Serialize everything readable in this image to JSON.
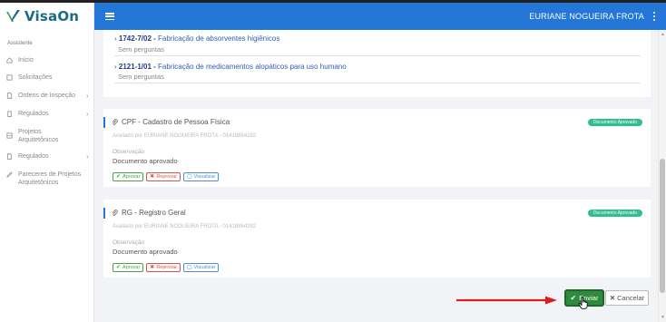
{
  "app": {
    "name": "VisaOn",
    "colors": {
      "header": "#2477d7",
      "logo_text": "#1c6b86",
      "success": "#2fbe8d",
      "send": "#2e8b3e"
    }
  },
  "header": {
    "menu_icon": "hamburger-icon",
    "user_name": "EURIANE NOGUEIRA FROTA",
    "options_icon": "kebab-icon"
  },
  "sidebar": {
    "section": "Assistente",
    "items": [
      {
        "label": "Início",
        "icon": "home-icon",
        "chevron": false
      },
      {
        "label": "Solicitações",
        "icon": "document-icon",
        "chevron": false
      },
      {
        "label": "Ordens de Inspeção",
        "icon": "file-icon",
        "chevron": true
      },
      {
        "label": "Regulados",
        "icon": "building-icon",
        "chevron": true
      },
      {
        "label": "Projetos Arquitetônicos",
        "icon": "blueprint-icon",
        "chevron": false
      },
      {
        "label": "Regulados",
        "icon": "file-icon",
        "chevron": true
      },
      {
        "label": "Pareceres de Projetos Arquitetônicos",
        "icon": "pen-icon",
        "chevron": false
      }
    ]
  },
  "activities": [
    {
      "code": "1742-7/02",
      "separator": " - ",
      "description": "Fabricação de absorventes higiênicos",
      "note": "Sem perguntas"
    },
    {
      "code": "2121-1/01",
      "separator": " - ",
      "description": "Fabricação de medicamentos alopáticos para uso humano",
      "note": "Sem perguntas"
    }
  ],
  "documents": [
    {
      "title": "CPF - Cadastro de Pessoa Física",
      "status": "Documento Aprovado",
      "evaluated_by": "Avaliado por EURIANE NOGUEIRA FROTA - 01418864282",
      "observation_label": "Observação",
      "observation": "Documento aprovado",
      "actions": {
        "approve": "Aprovar",
        "reject": "Reprovar",
        "view": "Visualizar"
      }
    },
    {
      "title": "RG - Registro Geral",
      "status": "Documento Aprovado",
      "evaluated_by": "Avaliado por EURIANE NOGUEIRA FROTA - 01418864282",
      "observation_label": "Observação",
      "observation": "Documento aprovado",
      "actions": {
        "approve": "Aprovar",
        "reject": "Reprovar",
        "view": "Visualizar"
      }
    }
  ],
  "footer": {
    "send_label": "Enviar",
    "cancel_label": "Cancelar"
  }
}
